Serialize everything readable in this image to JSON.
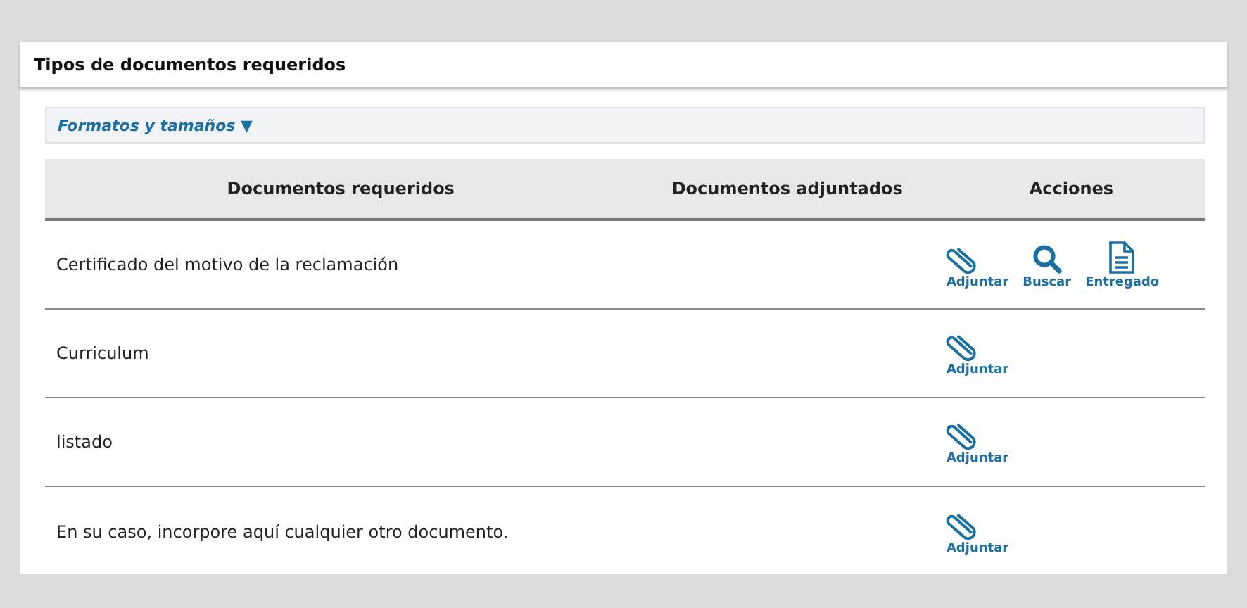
{
  "panel": {
    "title": "Tipos de documentos requeridos"
  },
  "formats_toggle": {
    "label": "Formatos y tamaños",
    "caret": "▼"
  },
  "table": {
    "columns": [
      "Documentos requeridos",
      "Documentos adjuntados",
      "Acciones"
    ],
    "rows": [
      {
        "document": "Certificado del motivo de la reclamación",
        "actions": [
          {
            "kind": "attach",
            "label": "Adjuntar"
          },
          {
            "kind": "search",
            "label": "Buscar"
          },
          {
            "kind": "delivered",
            "label": "Entregado"
          }
        ]
      },
      {
        "document": "Curriculum",
        "actions": [
          {
            "kind": "attach",
            "label": "Adjuntar"
          }
        ]
      },
      {
        "document": "listado",
        "actions": [
          {
            "kind": "attach",
            "label": "Adjuntar"
          }
        ]
      },
      {
        "document": "En su caso, incorpore aquí cualquier otro documento.",
        "actions": [
          {
            "kind": "attach",
            "label": "Adjuntar"
          }
        ]
      }
    ]
  }
}
